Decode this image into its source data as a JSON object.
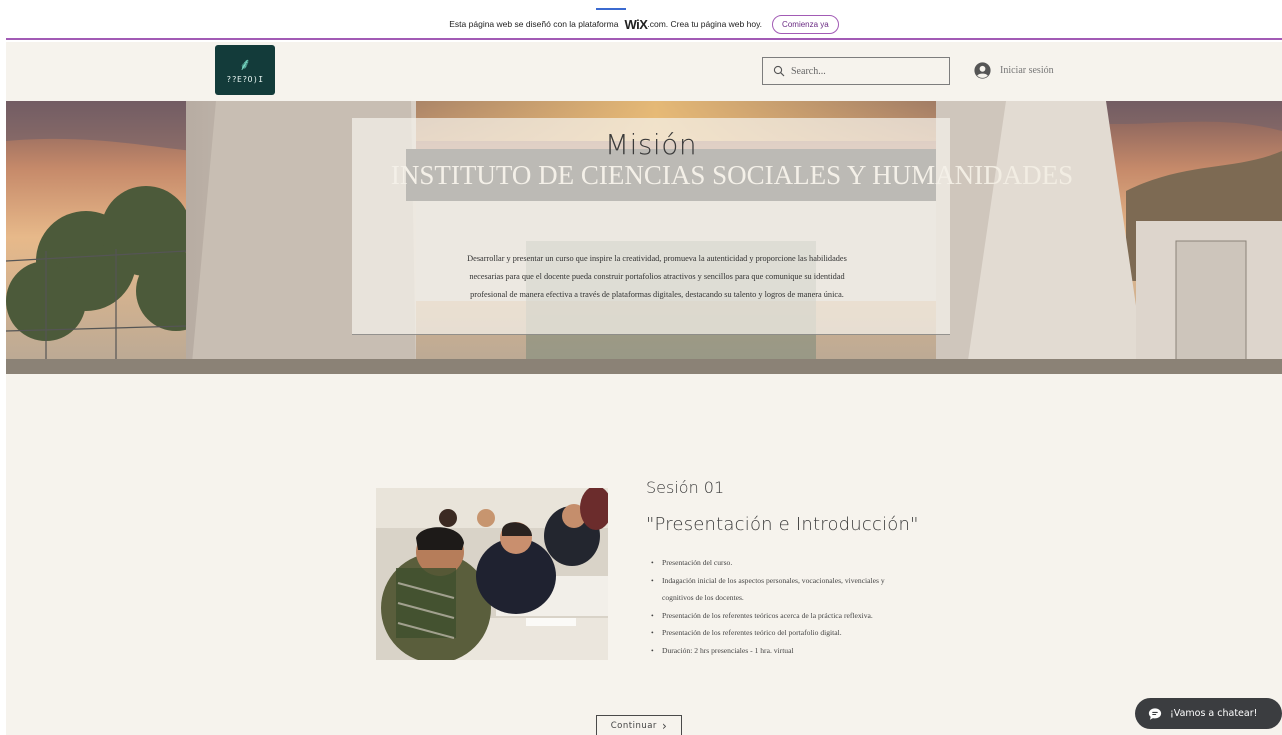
{
  "wix_banner": {
    "text_before": "Esta página web se diseñó con la plataforma",
    "brand": "WiX",
    "text_after": ".com. Crea tu página web hoy.",
    "cta": "Comienza ya"
  },
  "header": {
    "logo_glyph": "⸙",
    "logo_text": "??E?O)I",
    "search_placeholder": "Search...",
    "login_label": "Iniciar sesión"
  },
  "hero": {
    "title": "Misión",
    "building_sign": "INSTITUTO DE CIENCIAS SOCIALES Y HUMANIDADES",
    "text": "Desarrollar y presentar un curso que inspire la creatividad, promueva la autenticidad y proporcione las habilidades necesarias para que el docente pueda construir portafolios atractivos y sencillos para que comunique su identidad profesional de manera efectiva a través de plataformas digitales, destacando su talento y logros de manera única."
  },
  "session": {
    "title": "Sesión 01",
    "subtitle": "\"Presentación e Introducción\"",
    "items": [
      "Presentación del curso.",
      "Indagación inicial de los aspectos personales, vocacionales, vivenciales y cognitivos de los docentes.",
      "Presentación de los referentes teóricos acerca de la práctica reflexiva.",
      "Presentación de los referentes teórico del portafolio digital.",
      "Duración: 2 hrs presenciales - 1 hra. virtual"
    ],
    "continue_label": "Continuar",
    "continue_chevron": "›"
  },
  "chat": {
    "label": "¡Vamos a chatear!"
  },
  "colors": {
    "page_bg": "#f6f3ed",
    "wix_accent": "#a25bb5",
    "logo_bg": "#133b3a",
    "chat_bg": "#3b3d40"
  }
}
